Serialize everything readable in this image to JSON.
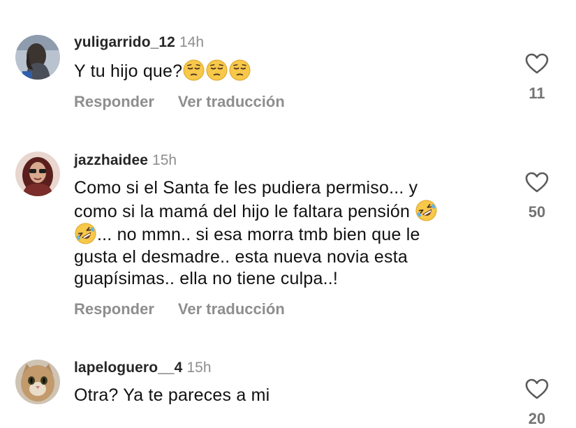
{
  "comments": [
    {
      "username": "yuligarrido_12",
      "time": "14h",
      "text_lines": [
        "Y tu hijo que?"
      ],
      "emoji": "pensive-face-emoji",
      "reply_label": "Responder",
      "translate_label": "Ver traducción",
      "likes": "11"
    },
    {
      "username": "jazzhaidee",
      "time": "15h",
      "text_lines": [
        "Como si el Santa fe les pudiera permiso... y",
        "como si la mamá del hijo le faltara pensión",
        "... no mmn.. si esa morra tmb bien que le",
        "gusta el desmadre.. esta nueva novia esta",
        "guapísimas.. ella no tiene culpa..!"
      ],
      "emoji": "rolling-on-floor-laughing-emoji",
      "reply_label": "Responder",
      "translate_label": "Ver traducción",
      "likes": "50"
    },
    {
      "username": "lapeloguero__4",
      "time": "15h",
      "text_lines": [
        "Otra? Ya te pareces a mi"
      ],
      "likes": "20"
    }
  ],
  "colors": {
    "text": "#111111",
    "muted": "#8e8e8e",
    "emoji_yellow": "#f7c84a"
  },
  "icons": {
    "like": "heart-outline-icon"
  }
}
